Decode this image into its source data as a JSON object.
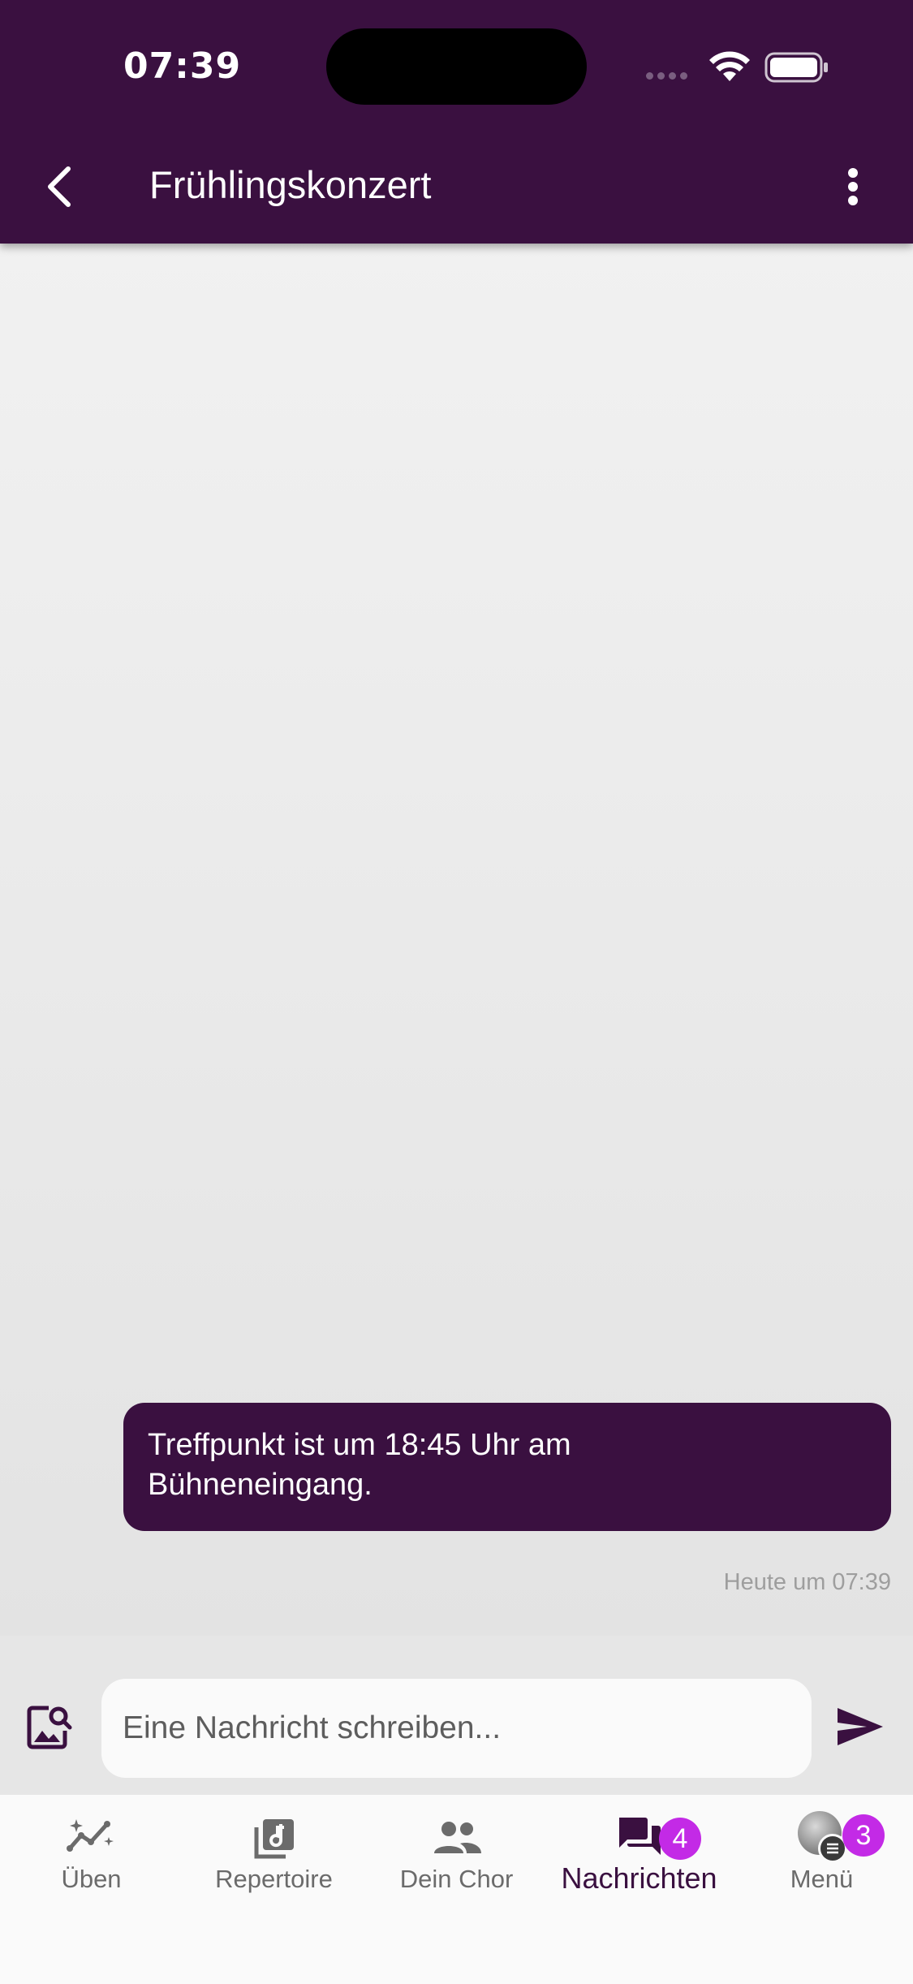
{
  "status_bar": {
    "time": "07:39"
  },
  "header": {
    "title": "Frühlingskonzert",
    "back_icon": "chevron-left-icon",
    "more_icon": "more-vertical-icon",
    "background_color": "#3a1040"
  },
  "messages": [
    {
      "text": "Treffpunkt ist um 18:45 Uhr am Bühneneingang.",
      "line1": "Treffpunkt ist um 18:45 Uhr am",
      "line2": "Bühneneingang.",
      "timestamp": "Heute um 07:39"
    }
  ],
  "composer": {
    "placeholder": "Eine Nachricht schreiben...",
    "attach_icon": "image-search-icon",
    "send_icon": "send-icon"
  },
  "bottom_nav": {
    "items": [
      {
        "label": "Üben",
        "icon": "practice-chart-icon"
      },
      {
        "label": "Repertoire",
        "icon": "music-library-icon"
      },
      {
        "label": "Dein Chor",
        "icon": "group-icon"
      },
      {
        "label": "Nachrichten",
        "icon": "chat-icon",
        "badge": "4",
        "active": true
      },
      {
        "label": "Menü",
        "icon": "avatar",
        "badge": "3"
      }
    ],
    "badge_color": "#c32ae6",
    "active_color": "#3a1040"
  }
}
